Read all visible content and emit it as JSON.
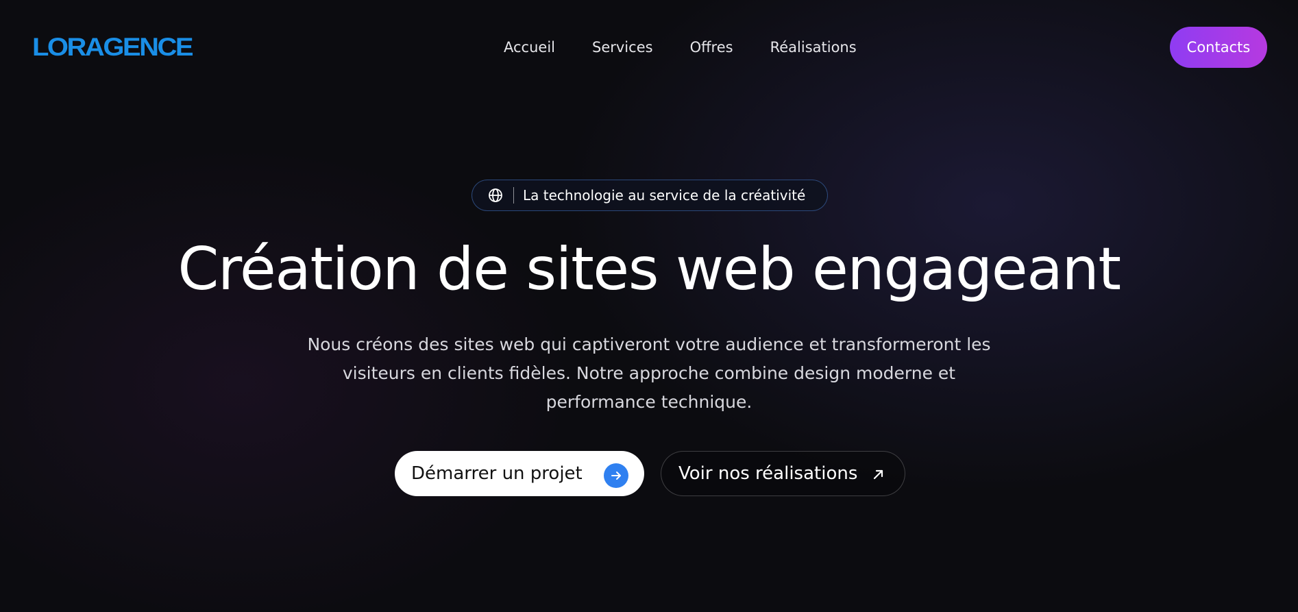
{
  "header": {
    "logo": "LORAGENCE",
    "nav": [
      "Accueil",
      "Services",
      "Offres",
      "Réalisations"
    ],
    "contacts_label": "Contacts"
  },
  "hero": {
    "badge_icon": "globe-icon",
    "badge_text": "La technologie au service de la créativité",
    "headline": "Création de sites web engageant",
    "subtitle": "Nous créons des sites web qui captiveront votre audience et transformeront les visiteurs en clients fidèles. Notre approche combine design moderne et performance technique.",
    "primary_cta": "Démarrer un projet",
    "primary_cta_icon": "arrow-right-icon",
    "secondary_cta": "Voir nos réalisations",
    "secondary_cta_icon": "arrow-up-right-icon"
  },
  "colors": {
    "background": "#0c0c10",
    "logo": "#1a8ee6",
    "contacts_gradient_start": "#8f3cf2",
    "contacts_gradient_end": "#b63ae0",
    "primary_arrow": "#2f80f0"
  }
}
